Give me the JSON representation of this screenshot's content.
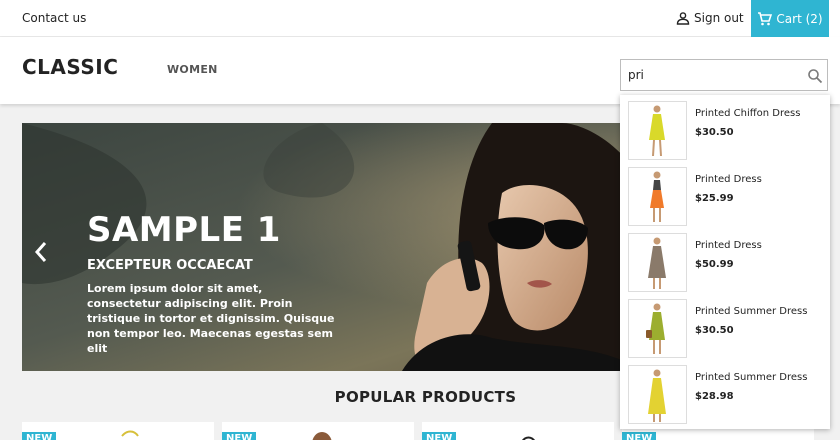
{
  "topbar": {
    "contact_label": "Contact us",
    "signout_label": "Sign out",
    "cart_label": "Cart (2)"
  },
  "header": {
    "logo": "CLASSIC",
    "menu_women": "WOMEN",
    "search_value": "pri"
  },
  "slider": {
    "title": "SAMPLE 1",
    "subtitle": "EXCEPTEUR OCCAECAT",
    "text": "Lorem ipsum dolor sit amet, consectetur adipiscing elit. Proin tristique in tortor et dignissim. Quisque non tempor leo. Maecenas egestas sem elit"
  },
  "popular_title": "POPULAR PRODUCTS",
  "new_badge": "NEW",
  "suggestions": [
    {
      "name": "Printed Chiffon Dress",
      "price": "$30.50",
      "dress_color": "#d9d92a"
    },
    {
      "name": "Printed Dress",
      "price": "$25.99",
      "dress_color": "#f07a2a"
    },
    {
      "name": "Printed Dress",
      "price": "$50.99",
      "dress_color": "#8a7a6a"
    },
    {
      "name": "Printed Summer Dress",
      "price": "$30.50",
      "dress_color": "#9cae2f"
    },
    {
      "name": "Printed Summer Dress",
      "price": "$28.98",
      "dress_color": "#e3d232"
    }
  ],
  "colors": {
    "accent": "#2fb5d2"
  }
}
